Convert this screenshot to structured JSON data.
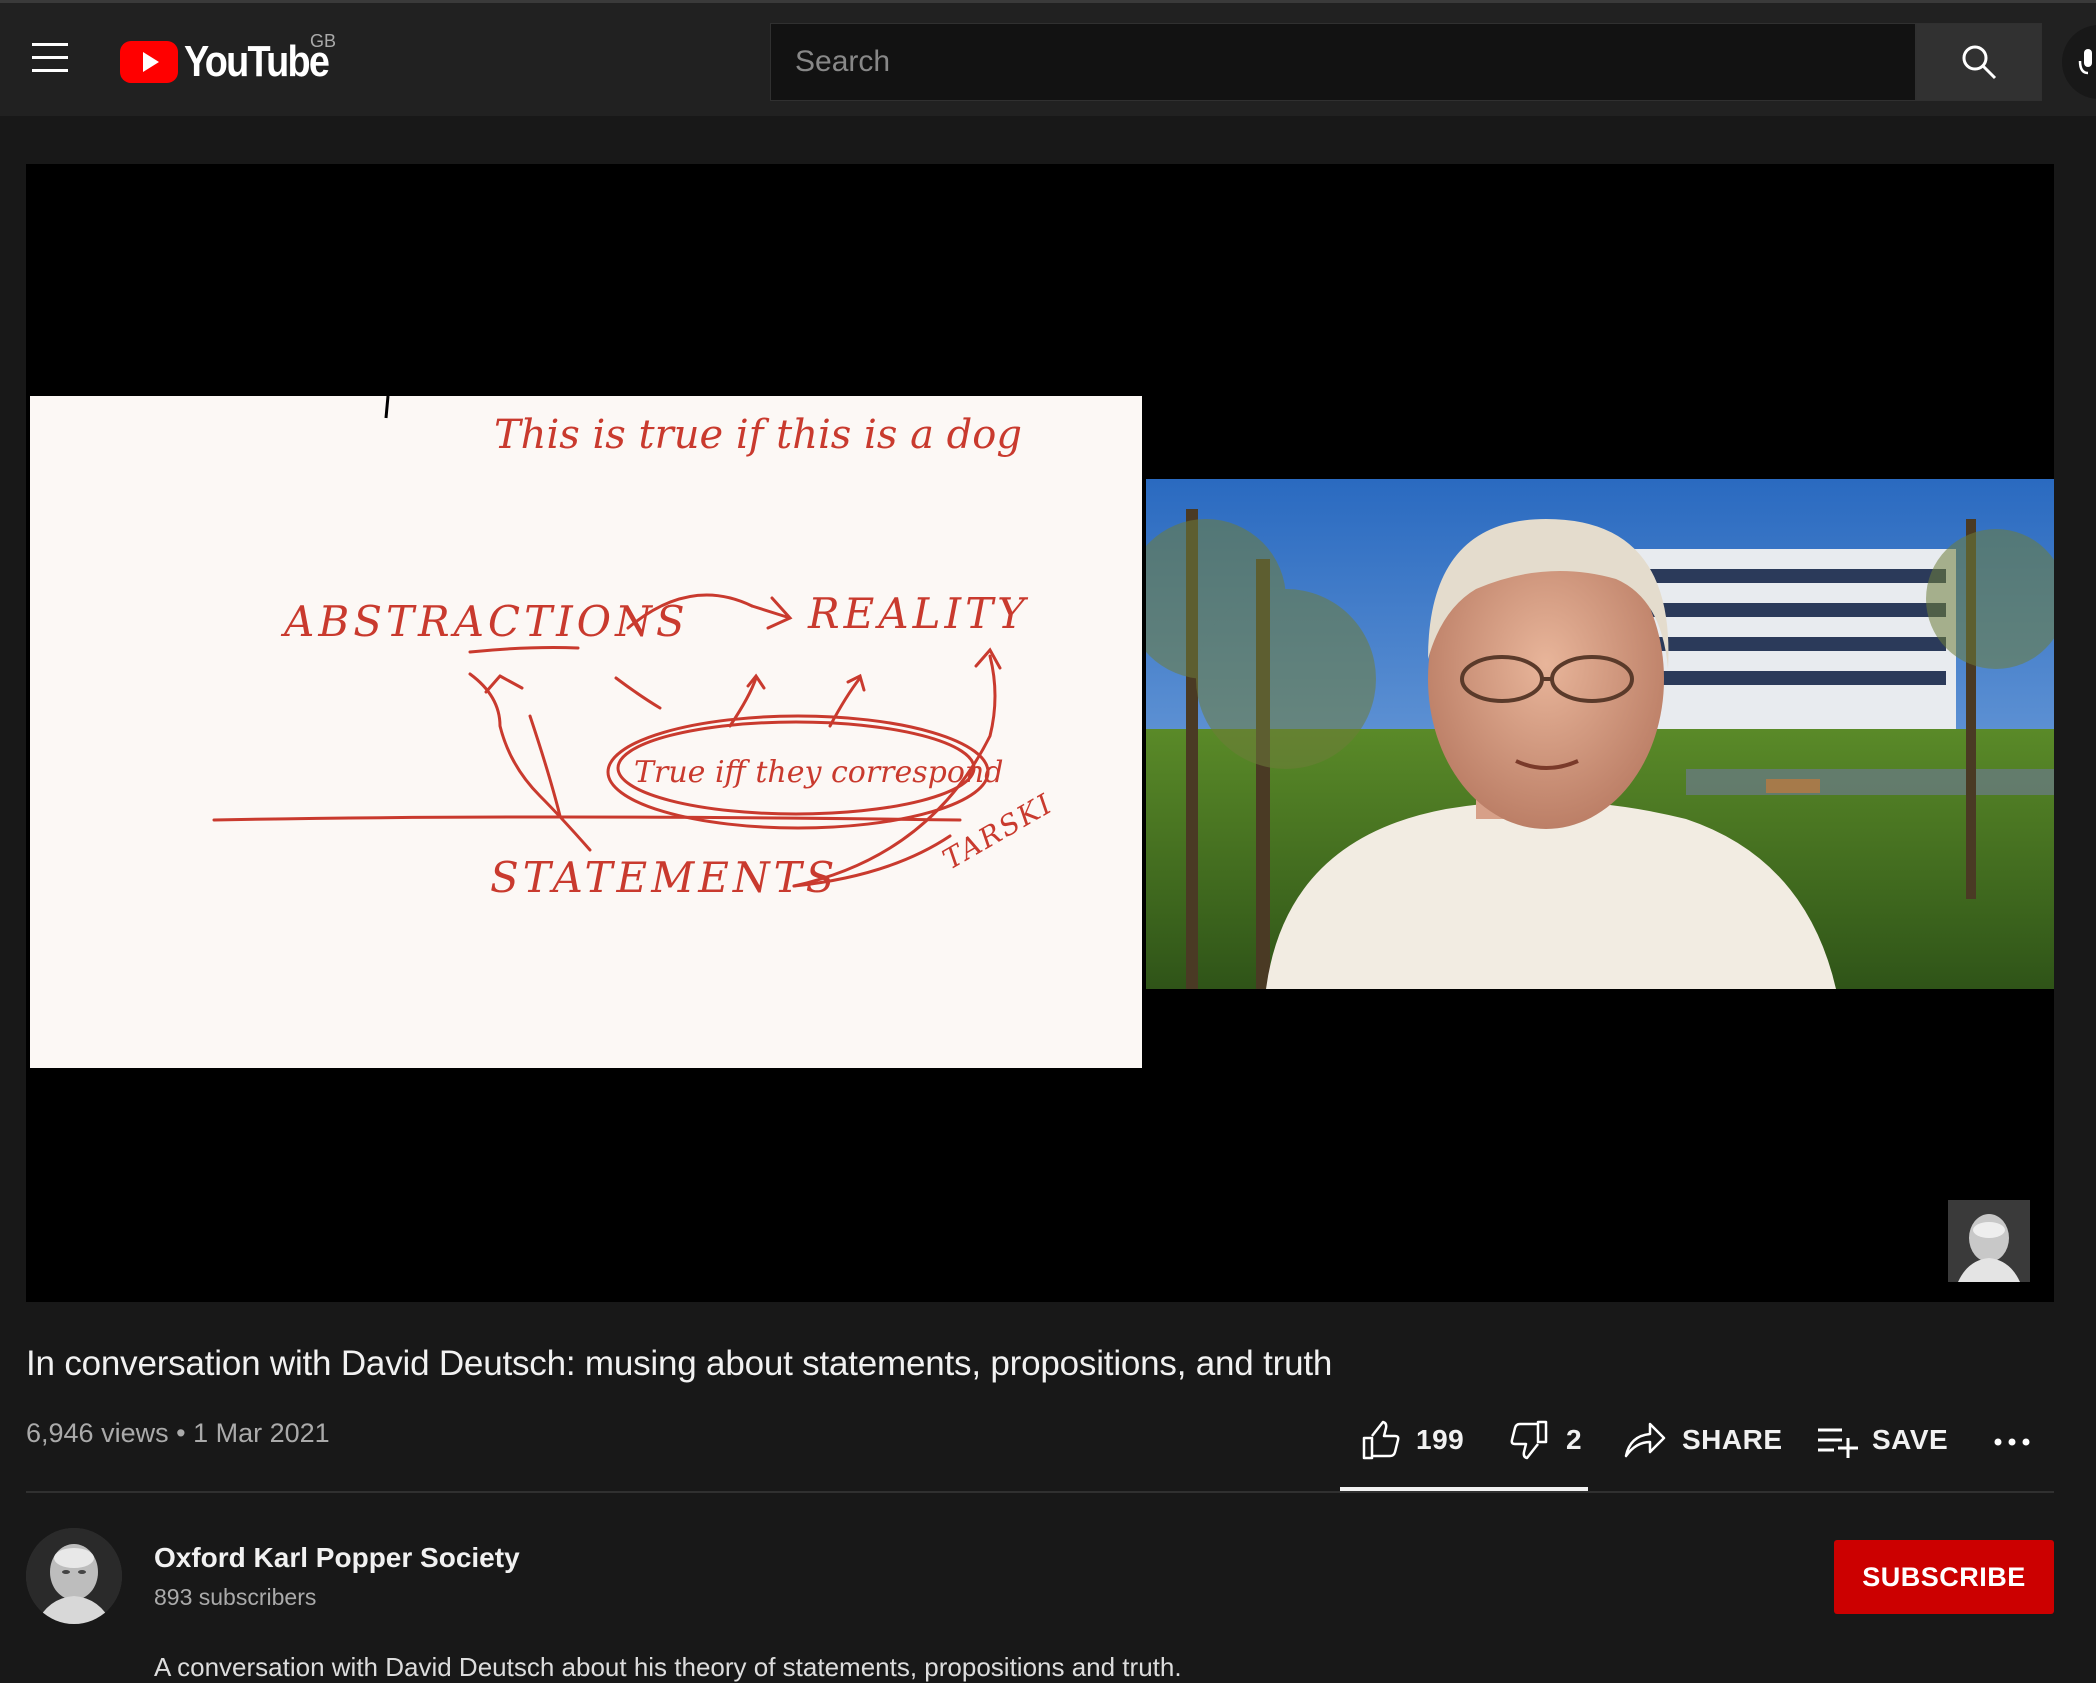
{
  "header": {
    "logo_text": "YouTube",
    "country_code": "GB",
    "search_placeholder": "Search",
    "brand_red": "#ff0000"
  },
  "whiteboard": {
    "line1": "This is true if this is a dog",
    "abstractions": "ABSTRACTIONS",
    "reality": "REALITY",
    "oval_text": "True iff they correspond",
    "statements": "STATEMENTS",
    "tarski": "TARSKI",
    "ink_color": "#c93a2e"
  },
  "video": {
    "title": "In conversation with David Deutsch: musing about statements, propositions, and truth",
    "views": "6,946 views",
    "separator": "•",
    "date": "1 Mar 2021"
  },
  "actions": {
    "likes": "199",
    "dislikes": "2",
    "share_label": "SHARE",
    "save_label": "SAVE"
  },
  "channel": {
    "name": "Oxford Karl Popper Society",
    "subscribers": "893 subscribers",
    "subscribe_label": "SUBSCRIBE"
  },
  "description": {
    "first_line": "A conversation with David Deutsch about his theory of statements, propositions and truth."
  }
}
